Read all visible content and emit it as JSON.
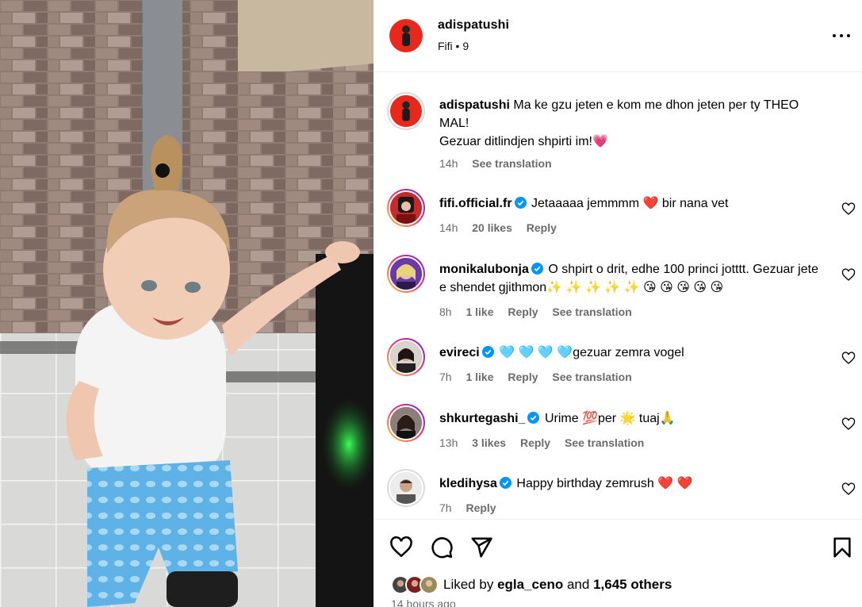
{
  "post": {
    "username": "adispatushi",
    "subtitle": "Fifi • 9",
    "more_icon": "more-horizontal-icon"
  },
  "caption": {
    "username": "adispatushi",
    "text_line1": "Ma ke gzu jeten e kom me dhon jeten per ty THEO MAL!",
    "text_line2": "Gezuar ditlindjen shpirti im!💗",
    "time": "14h",
    "see_translation": "See translation"
  },
  "comments": [
    {
      "username": "fifi.official.fr",
      "verified": true,
      "text": "Jetaaaaa jemmmm ❤️  bir nana vet",
      "time": "14h",
      "likes": "20 likes",
      "reply": "Reply",
      "see_translation": ""
    },
    {
      "username": "monikalubonja",
      "verified": true,
      "text": "O shpirt o drit, edhe 100 princi jotttt. Gezuar jete e shendet gjithmon✨ ✨ ✨ ✨ ✨ 😘 😘 😘 😘 😘",
      "time": "8h",
      "likes": "1 like",
      "reply": "Reply",
      "see_translation": "See translation"
    },
    {
      "username": "evireci",
      "verified": true,
      "text": "🩵 🩵 🩵 🩵gezuar zemra vogel",
      "time": "7h",
      "likes": "1 like",
      "reply": "Reply",
      "see_translation": "See translation"
    },
    {
      "username": "shkurtegashi_",
      "verified": true,
      "text": "Urime 💯per 🌟 tuaj🙏",
      "time": "13h",
      "likes": "3 likes",
      "reply": "Reply",
      "see_translation": "See translation"
    },
    {
      "username": "kledihysa",
      "verified": true,
      "text": "Happy birthday zemrush ❤️ ❤️",
      "time": "7h",
      "likes": "",
      "reply": "Reply",
      "see_translation": ""
    }
  ],
  "actions": {
    "like_icon": "heart-icon",
    "comment_icon": "comment-icon",
    "share_icon": "send-icon",
    "save_icon": "bookmark-icon"
  },
  "likes_summary": {
    "prefix": "Liked by",
    "user": "egla_ceno",
    "connector": "and",
    "others": "1,645 others"
  },
  "time_ago": "14 hours ago",
  "colors": {
    "verified_blue": "#0095f6",
    "muted_text": "#6b6b6b",
    "story_ring_start": "#f9ce34",
    "story_ring_mid": "#ee2a7b",
    "story_ring_end": "#6228d7"
  }
}
